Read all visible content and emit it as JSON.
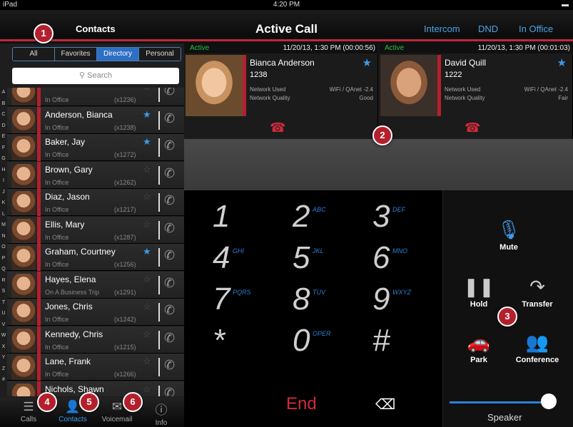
{
  "status": {
    "device": "iPad",
    "time": "4:20 PM"
  },
  "header": {
    "contacts_label": "Contacts",
    "title": "Active Call",
    "intercom": "Intercom",
    "dnd": "DND",
    "presence": "In Office"
  },
  "filters": [
    "All",
    "Favorites",
    "Directory",
    "Personal"
  ],
  "search": {
    "placeholder": "Search"
  },
  "alphabet": [
    "A",
    "B",
    "C",
    "D",
    "E",
    "F",
    "G",
    "H",
    "I",
    "J",
    "K",
    "L",
    "M",
    "N",
    "O",
    "P",
    "Q",
    "R",
    "S",
    "T",
    "U",
    "V",
    "W",
    "X",
    "Y",
    "Z",
    "#"
  ],
  "contacts": [
    {
      "name": "",
      "status": "In Office",
      "ext": "(x1236)",
      "fav": false
    },
    {
      "name": "Anderson, Bianca",
      "status": "In Office",
      "ext": "(x1238)",
      "fav": true
    },
    {
      "name": "Baker, Jay",
      "status": "In Office",
      "ext": "(x1272)",
      "fav": true
    },
    {
      "name": "Brown, Gary",
      "status": "In Office",
      "ext": "(x1262)",
      "fav": false
    },
    {
      "name": "Diaz, Jason",
      "status": "In Office",
      "ext": "(x1217)",
      "fav": false
    },
    {
      "name": "Ellis, Mary",
      "status": "In Office",
      "ext": "(x1287)",
      "fav": false
    },
    {
      "name": "Graham, Courtney",
      "status": "In Office",
      "ext": "(x1256)",
      "fav": true
    },
    {
      "name": "Hayes, Elena",
      "status": "On A Business Trip",
      "ext": "(x1291)",
      "fav": false
    },
    {
      "name": "Jones, Chris",
      "status": "In Office",
      "ext": "(x1242)",
      "fav": false
    },
    {
      "name": "Kennedy, Chris",
      "status": "In Office",
      "ext": "(x1215)",
      "fav": false
    },
    {
      "name": "Lane, Frank",
      "status": "In Office",
      "ext": "(x1266)",
      "fav": false
    },
    {
      "name": "Nichols, Shawn",
      "status": "",
      "ext": "",
      "fav": false
    }
  ],
  "tabs": [
    "Calls",
    "Contacts",
    "Voicemail",
    "Info"
  ],
  "calls": [
    {
      "state": "Active",
      "time": "11/20/13, 1:30 PM (00:00:56)",
      "name": "Bianca Anderson",
      "ext": "1238",
      "net_used_label": "Network Used",
      "net_used": "WiFi / QAnet -2.4",
      "net_quality_label": "Network Quality",
      "net_quality": "Good"
    },
    {
      "state": "Active",
      "time": "11/20/13, 1:30 PM (00:01:03)",
      "name": "David Quill",
      "ext": "1222",
      "net_used_label": "Network Used",
      "net_used": "WiFi / QAnet -2.4",
      "net_quality_label": "Network Quality",
      "net_quality": "Fair"
    }
  ],
  "keypad": [
    {
      "d": "1",
      "s": ""
    },
    {
      "d": "2",
      "s": "ABC"
    },
    {
      "d": "3",
      "s": "DEF"
    },
    {
      "d": "4",
      "s": "GHI"
    },
    {
      "d": "5",
      "s": "JKL"
    },
    {
      "d": "6",
      "s": "MNO"
    },
    {
      "d": "7",
      "s": "PQRS"
    },
    {
      "d": "8",
      "s": "TUV"
    },
    {
      "d": "9",
      "s": "WXYZ"
    },
    {
      "d": "*",
      "s": ""
    },
    {
      "d": "0",
      "s": "OPER"
    },
    {
      "d": "#",
      "s": ""
    }
  ],
  "end_label": "End",
  "controls": {
    "mute": "Mute",
    "hold": "Hold",
    "transfer": "Transfer",
    "park": "Park",
    "conference": "Conference",
    "speaker": "Speaker"
  },
  "badges": [
    "1",
    "2",
    "3",
    "4",
    "5",
    "6"
  ]
}
